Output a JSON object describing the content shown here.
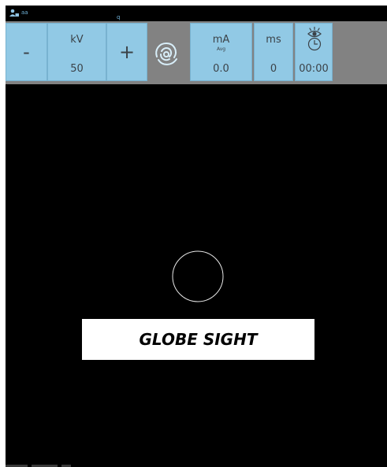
{
  "title_bar": {
    "icon": "user-icon",
    "user_label": "aa",
    "title_text": "q"
  },
  "toolbar": {
    "kv_decrease_label": "-",
    "kv_label": "kV",
    "kv_value": "50",
    "kv_increase_label": "+",
    "spinner_icon": "spinning-radiation-icon",
    "ma_label": "mA",
    "ma_sublabel": "Avg",
    "ma_value": "0.0",
    "ms_label": "ms",
    "ms_value": "0",
    "timer_icon": "eye-clock-icon",
    "timer_value": "00:00"
  },
  "viewport": {
    "overlay_text": "GLOBE SIGHT"
  },
  "colors": {
    "tile_background": "#91c9e5",
    "toolbar_background": "#828282",
    "viewport_background": "#000000",
    "accent_text": "#6fb0d6"
  }
}
